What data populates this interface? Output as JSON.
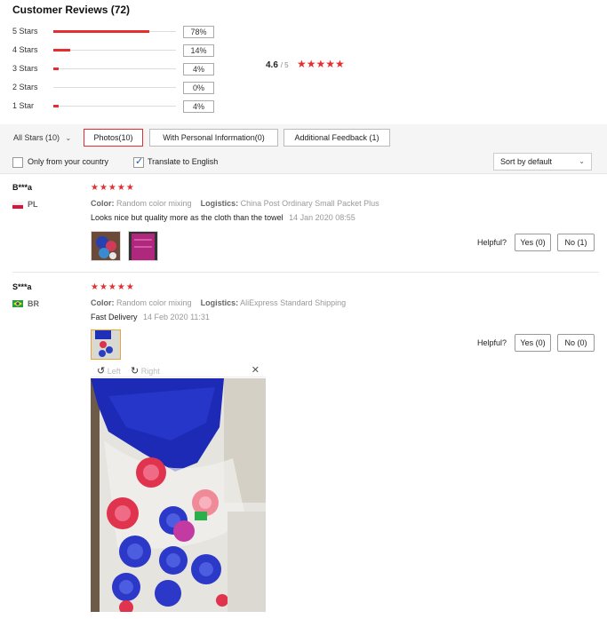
{
  "summary": {
    "title": "Customer Reviews (72)",
    "distribution": [
      {
        "label": "5 Stars",
        "percent": "78%",
        "fraction": 0.78
      },
      {
        "label": "4 Stars",
        "percent": "14%",
        "fraction": 0.14
      },
      {
        "label": "3 Stars",
        "percent": "4%",
        "fraction": 0.04
      },
      {
        "label": "2 Stars",
        "percent": "0%",
        "fraction": 0.0
      },
      {
        "label": "1 Star",
        "percent": "4%",
        "fraction": 0.04
      }
    ],
    "average": "4.6",
    "average_of": "/ 5",
    "average_stars": "★★★★★"
  },
  "filters": {
    "all_stars": "All Stars (10)",
    "all_stars_caret": "⌄",
    "photos": "Photos(10)",
    "personal": "With Personal Information(0)",
    "additional": "Additional Feedback (1)",
    "only_country": "Only from your country",
    "only_country_checked": false,
    "translate": "Translate to English",
    "translate_checked": true,
    "sort": "Sort by default",
    "sort_caret": "⌄"
  },
  "reviews": [
    {
      "name": "B***a",
      "country": "PL",
      "stars": "★★★★★",
      "color_label": "Color:",
      "color_value": "Random color mixing",
      "logistics_label": "Logistics:",
      "logistics_value": "China Post Ordinary Small Packet Plus",
      "text": "Looks nice but quality more as the cloth than the towel",
      "date": "14 Jan 2020 08:55",
      "helpful": "Helpful?",
      "yes": "Yes (0)",
      "no": "No (1)"
    },
    {
      "name": "S***a",
      "country": "BR",
      "stars": "★★★★★",
      "color_label": "Color:",
      "color_value": "Random color mixing",
      "logistics_label": "Logistics:",
      "logistics_value": "AliExpress Standard Shipping",
      "text": "Fast Delivery",
      "date": "14 Feb 2020 11:31",
      "helpful": "Helpful?",
      "yes": "Yes (0)",
      "no": "No (0)"
    }
  ],
  "viewer": {
    "left": "Left",
    "right": "Right",
    "close": "✕",
    "rotate_left_icon": "↺",
    "rotate_right_icon": "↻"
  },
  "colors": {
    "accent": "#e62e2e",
    "towel_blue": "#1f2fb8",
    "background_gray": "#f5f5f5"
  }
}
